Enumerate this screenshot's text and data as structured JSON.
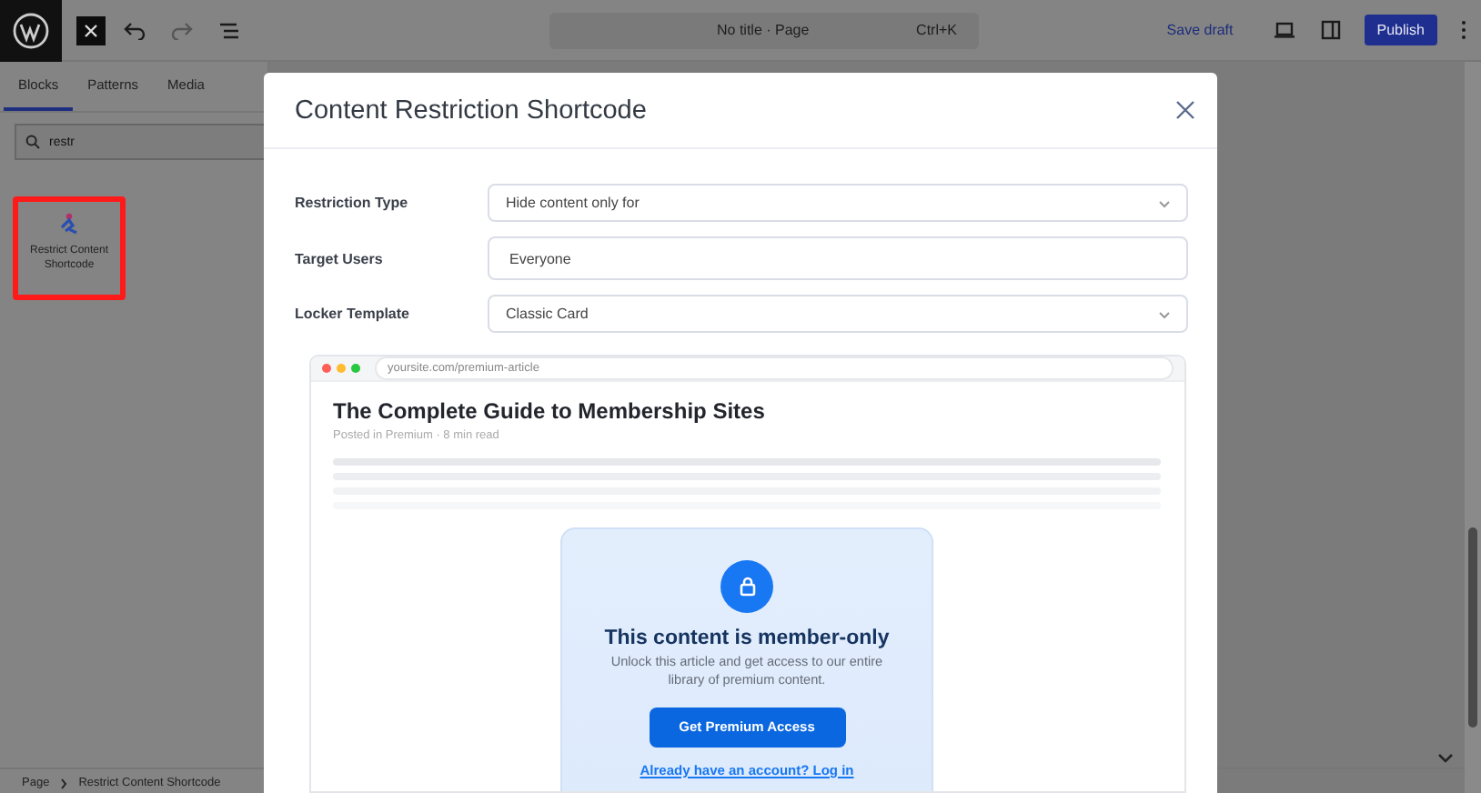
{
  "topbar": {
    "title": "No title · Page",
    "shortcut": "Ctrl+K",
    "save_draft": "Save draft",
    "publish": "Publish"
  },
  "sidebar": {
    "tabs": [
      {
        "label": "Blocks",
        "selected": true
      },
      {
        "label": "Patterns",
        "selected": false
      },
      {
        "label": "Media",
        "selected": false
      }
    ],
    "search": {
      "value": "restr"
    },
    "results": [
      {
        "label": "Restrict Content Shortcode",
        "selected": true
      }
    ]
  },
  "modal": {
    "title": "Content Restriction Shortcode",
    "fields": [
      {
        "label": "Restriction Type",
        "kind": "select",
        "value": "Hide content only for"
      },
      {
        "label": "Target Users",
        "kind": "input",
        "value": "Everyone"
      },
      {
        "label": "Locker Template",
        "kind": "select",
        "value": "Classic Card"
      }
    ],
    "preview": {
      "url": "yoursite.com/premium-article",
      "title": "The Complete Guide to Membership Sites",
      "meta": "Posted in Premium · 8 min read",
      "locker": {
        "heading": "This content is member-only",
        "message": "Unlock this article and get access to our entire library of premium content.",
        "button": "Get Premium Access",
        "link": "Already have an account? Log in"
      }
    }
  },
  "breadcrumb": [
    "Page",
    "Restrict Content Shortcode"
  ]
}
